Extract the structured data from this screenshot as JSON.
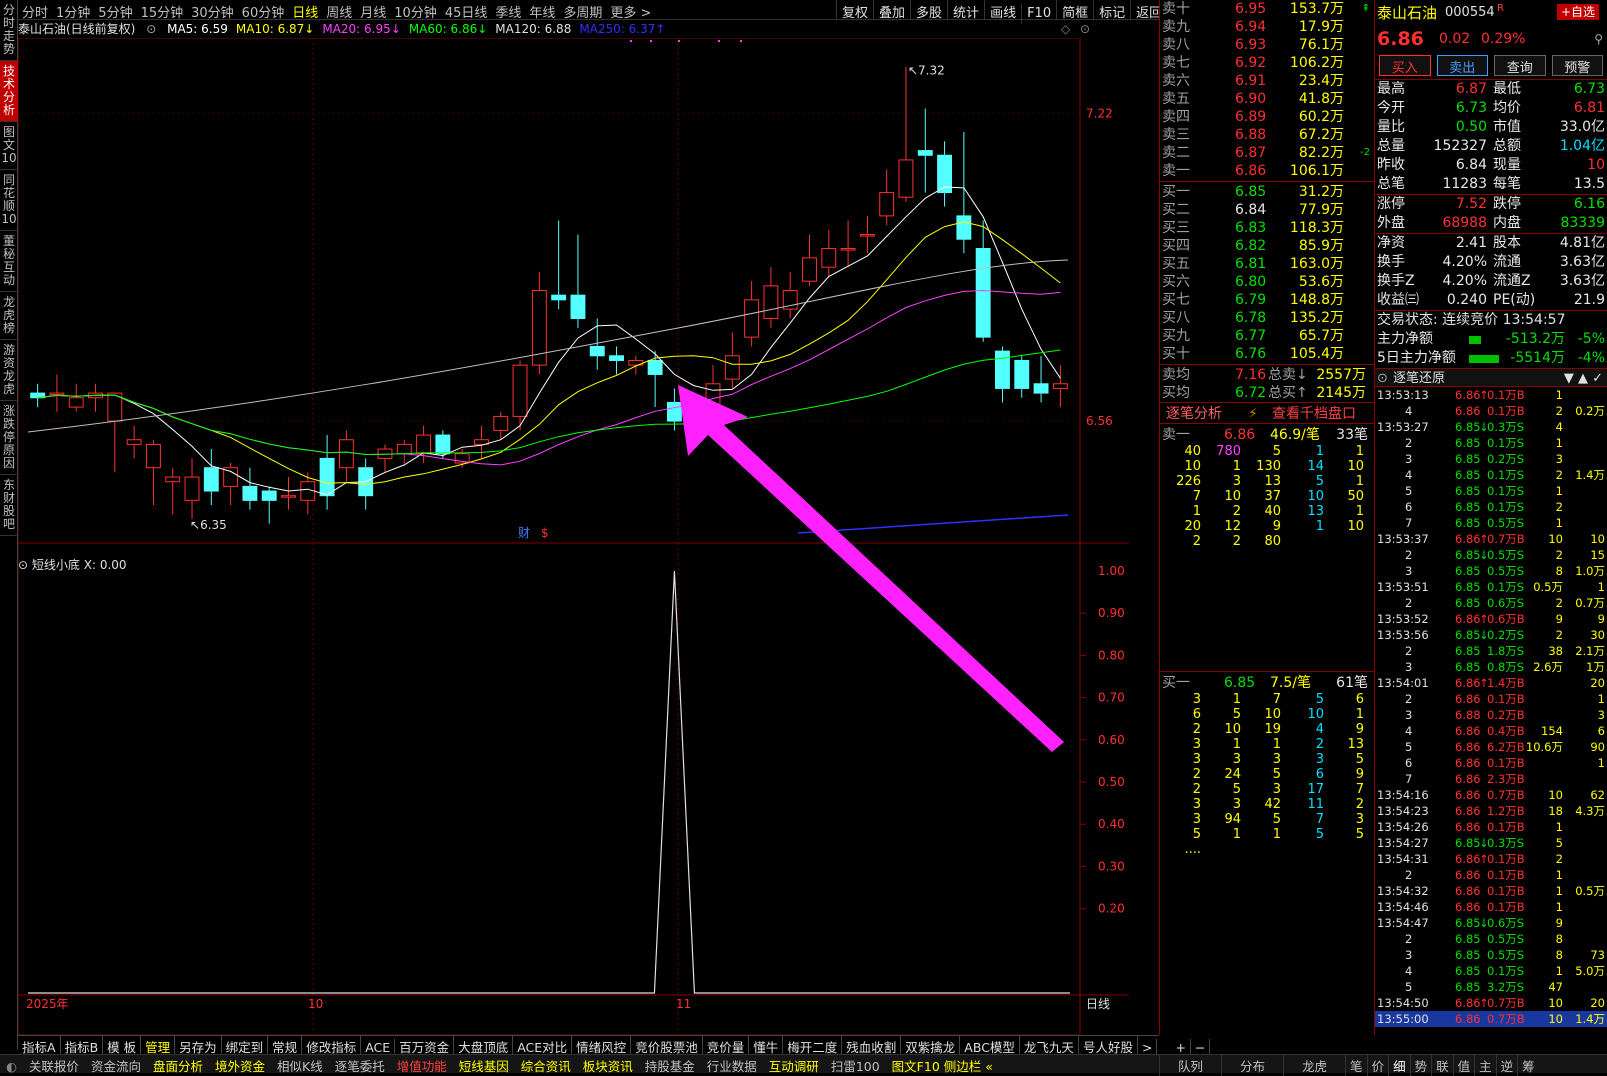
{
  "left_tabs": [
    "分时走势",
    "技术分析",
    "图文10",
    "同花顺10",
    "董秘互动",
    "龙虎榜",
    "游资龙虎",
    "涨跌停原因",
    "东财股吧"
  ],
  "left_tab_active": 1,
  "periods": [
    "分时",
    "1分钟",
    "5分钟",
    "15分钟",
    "30分钟",
    "60分钟",
    "日线",
    "周线",
    "月线",
    "10分钟",
    "45日线",
    "季线",
    "年线",
    "多周期",
    "更多 >"
  ],
  "period_selected": 6,
  "toolbar": [
    "复权",
    "叠加",
    "多股",
    "统计",
    "画线",
    "F10",
    "简框",
    "标记",
    "返回"
  ],
  "chart_header": {
    "title": "泰山石油(日线前复权)",
    "ma": [
      {
        "label": "MA5: 6.59",
        "color": "#ffffff"
      },
      {
        "label": "MA10: 6.87↓",
        "color": "#ffff00"
      },
      {
        "label": "MA20: 6.95↓",
        "color": "#ff40ff"
      },
      {
        "label": "MA60: 6.86↓",
        "color": "#00ff00"
      },
      {
        "label": "MA120: 6.88",
        "color": "#e0e0e0"
      },
      {
        "label": "MA250: 6.37↑",
        "color": "#3030ff"
      }
    ]
  },
  "chart_data": {
    "type": "candlestick",
    "y_axis_labels": [
      "7.22",
      "6.56"
    ],
    "high_label": "7.32",
    "low_label": "6.35",
    "x_labels": [
      "2025年",
      "10",
      "11"
    ],
    "markers": [
      "财",
      "$"
    ],
    "candles": [
      [
        6.62,
        6.61,
        6.64,
        6.59
      ],
      [
        6.62,
        6.62,
        6.66,
        6.58
      ],
      [
        6.59,
        6.61,
        6.64,
        6.58
      ],
      [
        6.61,
        6.62,
        6.64,
        6.58
      ],
      [
        6.56,
        6.62,
        6.6,
        6.45
      ],
      [
        6.51,
        6.52,
        6.55,
        6.48
      ],
      [
        6.46,
        6.51,
        6.52,
        6.38
      ],
      [
        6.43,
        6.44,
        6.46,
        6.36
      ],
      [
        6.39,
        6.44,
        6.48,
        6.35
      ],
      [
        6.46,
        6.41,
        6.5,
        6.38
      ],
      [
        6.42,
        6.46,
        6.47,
        6.38
      ],
      [
        6.42,
        6.39,
        6.46,
        6.37
      ],
      [
        6.41,
        6.39,
        6.42,
        6.34
      ],
      [
        6.4,
        6.4,
        6.44,
        6.37
      ],
      [
        6.39,
        6.43,
        6.45,
        6.36
      ],
      [
        6.48,
        6.4,
        6.53,
        6.37
      ],
      [
        6.46,
        6.52,
        6.54,
        6.43
      ],
      [
        6.46,
        6.4,
        6.48,
        6.37
      ],
      [
        6.48,
        6.5,
        6.51,
        6.45
      ],
      [
        6.49,
        6.51,
        6.52,
        6.47
      ],
      [
        6.49,
        6.53,
        6.55,
        6.47
      ],
      [
        6.53,
        6.49,
        6.54,
        6.48
      ],
      [
        6.47,
        6.49,
        6.5,
        6.46
      ],
      [
        6.51,
        6.52,
        6.55,
        6.48
      ],
      [
        6.54,
        6.57,
        6.58,
        6.52
      ],
      [
        6.57,
        6.68,
        6.69,
        6.54
      ],
      [
        6.68,
        6.84,
        6.88,
        6.66
      ],
      [
        6.83,
        6.82,
        6.99,
        6.8
      ],
      [
        6.83,
        6.78,
        6.96,
        6.76
      ],
      [
        6.72,
        6.7,
        6.78,
        6.67
      ],
      [
        6.7,
        6.69,
        6.72,
        6.66
      ],
      [
        6.68,
        6.69,
        6.7,
        6.66
      ],
      [
        6.69,
        6.66,
        6.71,
        6.59
      ],
      [
        6.6,
        6.56,
        6.63,
        6.54
      ],
      [
        6.56,
        6.58,
        6.6,
        6.53
      ],
      [
        6.58,
        6.64,
        6.68,
        6.56
      ],
      [
        6.65,
        6.7,
        6.75,
        6.63
      ],
      [
        6.74,
        6.82,
        6.86,
        6.72
      ],
      [
        6.78,
        6.85,
        6.89,
        6.76
      ],
      [
        6.8,
        6.84,
        6.88,
        6.78
      ],
      [
        6.86,
        6.91,
        6.96,
        6.85
      ],
      [
        6.89,
        6.93,
        6.97,
        6.87
      ],
      [
        6.93,
        6.93,
        6.99,
        6.89
      ],
      [
        6.96,
        6.96,
        7.0,
        6.92
      ],
      [
        7.0,
        7.05,
        7.1,
        6.98
      ],
      [
        7.04,
        7.12,
        7.32,
        7.03
      ],
      [
        7.14,
        7.13,
        7.23,
        7.05
      ],
      [
        7.13,
        7.05,
        7.16,
        7.02
      ],
      [
        7.0,
        6.95,
        7.18,
        6.92
      ],
      [
        6.93,
        6.74,
        6.99,
        6.73
      ],
      [
        6.71,
        6.63,
        6.72,
        6.6
      ],
      [
        6.69,
        6.63,
        6.7,
        6.61
      ],
      [
        6.64,
        6.62,
        6.7,
        6.6
      ],
      [
        6.63,
        6.64,
        6.68,
        6.59
      ]
    ],
    "indicator": {
      "title": "短线小底",
      "x_label": "X: 0.00",
      "y_ticks": [
        "1.00",
        "0.90",
        "0.80",
        "0.70",
        "0.60",
        "0.50",
        "0.40",
        "0.30",
        "0.20"
      ],
      "spike_index": 33,
      "spike_value": 1.0
    },
    "bottom_label": "日线"
  },
  "indicator_tabs": [
    "指标A",
    "指标B",
    "模 板",
    "管理",
    "另存为",
    "绑定到",
    "常规",
    "修改指标",
    "ACE",
    "百万资金",
    "大盘顶底",
    "ACE对比",
    "情绪风控",
    "竞价股票池",
    "竞价量",
    "懂牛",
    "梅开二度",
    "残血收割",
    "双紫擒龙",
    "ABC模型",
    "龙飞九天",
    "号人好股"
  ],
  "indicator_tab_selected": 3,
  "bottom_bar": [
    {
      "t": "关联报价",
      "c": ""
    },
    {
      "t": "资金流向",
      "c": ""
    },
    {
      "t": "盘面分析",
      "c": "y"
    },
    {
      "t": "境外资金",
      "c": "y"
    },
    {
      "t": "相似K线",
      "c": ""
    },
    {
      "t": "逐笔委托",
      "c": ""
    },
    {
      "t": "增值功能",
      "c": "r"
    },
    {
      "t": "短线基因",
      "c": "y"
    },
    {
      "t": "综合资讯",
      "c": "y"
    },
    {
      "t": "板块资讯",
      "c": "y"
    },
    {
      "t": "持股基金",
      "c": ""
    },
    {
      "t": "行业数据",
      "c": ""
    },
    {
      "t": "互动调研",
      "c": "y"
    },
    {
      "t": "扫雷100",
      "c": ""
    },
    {
      "t": "图文F10 侧边栏 «",
      "c": "y"
    }
  ],
  "bottom_right_tabs": [
    "队列",
    "分布",
    "龙虎",
    "笔",
    "价",
    "细",
    "势",
    "联",
    "值",
    "主",
    "逆",
    "筹"
  ],
  "orderbook": {
    "sells": [
      {
        "l": "卖十",
        "p": "6.95",
        "v": "153.7万",
        "c": "red",
        "mark": "⇞"
      },
      {
        "l": "卖九",
        "p": "6.94",
        "v": "17.9万",
        "c": "red",
        "mark": ""
      },
      {
        "l": "卖八",
        "p": "6.93",
        "v": "76.1万",
        "c": "red",
        "mark": ""
      },
      {
        "l": "卖七",
        "p": "6.92",
        "v": "106.2万",
        "c": "red",
        "mark": ""
      },
      {
        "l": "卖六",
        "p": "6.91",
        "v": "23.4万",
        "c": "red",
        "mark": ""
      },
      {
        "l": "卖五",
        "p": "6.90",
        "v": "41.8万",
        "c": "red",
        "mark": ""
      },
      {
        "l": "卖四",
        "p": "6.89",
        "v": "60.2万",
        "c": "red",
        "mark": ""
      },
      {
        "l": "卖三",
        "p": "6.88",
        "v": "67.2万",
        "c": "red",
        "mark": ""
      },
      {
        "l": "卖二",
        "p": "6.87",
        "v": "82.2万",
        "c": "red",
        "mark": "-2"
      },
      {
        "l": "卖一",
        "p": "6.86",
        "v": "106.1万",
        "c": "red",
        "mark": ""
      }
    ],
    "buys": [
      {
        "l": "买一",
        "p": "6.85",
        "v": "31.2万",
        "c": "grn"
      },
      {
        "l": "买二",
        "p": "6.84",
        "v": "77.9万",
        "c": "wht"
      },
      {
        "l": "买三",
        "p": "6.83",
        "v": "118.3万",
        "c": "grn"
      },
      {
        "l": "买四",
        "p": "6.82",
        "v": "85.9万",
        "c": "grn"
      },
      {
        "l": "买五",
        "p": "6.81",
        "v": "163.0万",
        "c": "grn"
      },
      {
        "l": "买六",
        "p": "6.80",
        "v": "53.6万",
        "c": "grn"
      },
      {
        "l": "买七",
        "p": "6.79",
        "v": "148.8万",
        "c": "grn"
      },
      {
        "l": "买八",
        "p": "6.78",
        "v": "135.2万",
        "c": "grn"
      },
      {
        "l": "买九",
        "p": "6.77",
        "v": "65.7万",
        "c": "grn"
      },
      {
        "l": "买十",
        "p": "6.76",
        "v": "105.4万",
        "c": "grn"
      }
    ],
    "avg_sell": {
      "l": "卖均",
      "p": "7.16",
      "tl": "总卖",
      "v": "2557万"
    },
    "avg_buy": {
      "l": "买均",
      "p": "6.72",
      "tl": "总买",
      "v": "2145万"
    },
    "tab1": "逐笔分析",
    "tab2": "查看千档盘口",
    "sell1_hdr": {
      "l": "卖一",
      "p": "6.86",
      "v": "46.9/笔",
      "n": "33笔"
    },
    "sell1_queue": [
      [
        "40",
        "780",
        "5",
        "1",
        "1"
      ],
      [
        "10",
        "1",
        "130",
        "14",
        "10"
      ],
      [
        "226",
        "3",
        "13",
        "5",
        "1"
      ],
      [
        "7",
        "10",
        "37",
        "10",
        "50"
      ],
      [
        "1",
        "2",
        "40",
        "13",
        "1"
      ],
      [
        "20",
        "12",
        "9",
        "1",
        "10"
      ],
      [
        "2",
        "2",
        "80",
        "",
        ""
      ]
    ],
    "buy1_hdr": {
      "l": "买一",
      "p": "6.85",
      "v": "7.5/笔",
      "n": "61笔"
    },
    "buy1_queue": [
      [
        "3",
        "1",
        "7",
        "5",
        "6"
      ],
      [
        "6",
        "5",
        "10",
        "10",
        "1"
      ],
      [
        "2",
        "10",
        "19",
        "4",
        "9"
      ],
      [
        "3",
        "1",
        "1",
        "2",
        "13"
      ],
      [
        "3",
        "3",
        "3",
        "3",
        "5"
      ],
      [
        "2",
        "24",
        "5",
        "6",
        "9"
      ],
      [
        "2",
        "5",
        "3",
        "17",
        "7"
      ],
      [
        "3",
        "3",
        "42",
        "11",
        "2"
      ],
      [
        "3",
        "94",
        "5",
        "7",
        "3"
      ],
      [
        "5",
        "1",
        "1",
        "5",
        "5"
      ],
      [
        "....",
        "",
        "",
        "",
        ""
      ]
    ]
  },
  "stock": {
    "name": "泰山石油",
    "code": "000554",
    "r_badge": "R",
    "add_btn": "+自选",
    "price": "6.86",
    "change": "0.02",
    "pct": "0.29%",
    "buttons": [
      "买入",
      "卖出",
      "查询",
      "预警"
    ],
    "stats": [
      [
        {
          "l": "最高",
          "v": "6.87",
          "c": "red"
        },
        {
          "l": "最低",
          "v": "6.73",
          "c": "grn"
        }
      ],
      [
        {
          "l": "今开",
          "v": "6.73",
          "c": "grn"
        },
        {
          "l": "均价",
          "v": "6.81",
          "c": "red"
        }
      ],
      [
        {
          "l": "量比",
          "v": "0.50",
          "c": "grn"
        },
        {
          "l": "市值",
          "v": "33.0亿",
          "c": "wht"
        }
      ],
      [
        {
          "l": "总量",
          "v": "152327",
          "c": "wht"
        },
        {
          "l": "总额",
          "v": "1.04亿",
          "c": "cyan"
        }
      ],
      [
        {
          "l": "昨收",
          "v": "6.84",
          "c": "wht"
        },
        {
          "l": "现量",
          "v": "10",
          "c": "red"
        }
      ],
      [
        {
          "l": "总笔",
          "v": "11283",
          "c": "wht"
        },
        {
          "l": "每笔",
          "v": "13.5",
          "c": "wht"
        }
      ],
      [
        {
          "l": "涨停",
          "v": "7.52",
          "c": "red"
        },
        {
          "l": "跌停",
          "v": "6.16",
          "c": "grn"
        }
      ],
      [
        {
          "l": "外盘",
          "v": "68988",
          "c": "red"
        },
        {
          "l": "内盘",
          "v": "83339",
          "c": "grn"
        }
      ],
      [
        {
          "l": "净资",
          "v": "2.41",
          "c": "wht"
        },
        {
          "l": "股本",
          "v": "4.81亿",
          "c": "wht"
        }
      ],
      [
        {
          "l": "换手",
          "v": "4.20%",
          "c": "wht"
        },
        {
          "l": "流通",
          "v": "3.63亿",
          "c": "wht"
        }
      ],
      [
        {
          "l": "换手Z",
          "v": "4.20%",
          "c": "wht"
        },
        {
          "l": "流通Z",
          "v": "3.63亿",
          "c": "wht"
        }
      ],
      [
        {
          "l": "收益㈢",
          "v": "0.240",
          "c": "wht"
        },
        {
          "l": "PE(动)",
          "v": "21.9",
          "c": "wht"
        }
      ]
    ],
    "trade_status": "交易状态: 连续竞价 13:54:57",
    "main_net": {
      "l": "主力净额",
      "v": "-513.2万",
      "p": "-5%"
    },
    "main5_net": {
      "l": "5日主力净额",
      "v": "-5514万",
      "p": "-4%"
    },
    "tick_title": "逐笔还原"
  },
  "ticks": [
    {
      "t": "13:53:13",
      "p": "6.86",
      "d": "↑",
      "v": "0.1万",
      "s": "B",
      "n": "1",
      "x": "",
      "c": "red"
    },
    {
      "t": "4",
      "p": "6.86",
      "d": "",
      "v": "0.1万",
      "s": "B",
      "n": "2",
      "x": "0.2万",
      "c": "red"
    },
    {
      "t": "13:53:27",
      "p": "6.85",
      "d": "↓",
      "v": "0.3万",
      "s": "S",
      "n": "4",
      "x": "",
      "c": "grn"
    },
    {
      "t": "2",
      "p": "6.85",
      "d": "",
      "v": "0.1万",
      "s": "S",
      "n": "1",
      "x": "",
      "c": "grn"
    },
    {
      "t": "3",
      "p": "6.85",
      "d": "",
      "v": "0.2万",
      "s": "S",
      "n": "3",
      "x": "",
      "c": "grn"
    },
    {
      "t": "4",
      "p": "6.85",
      "d": "",
      "v": "0.1万",
      "s": "S",
      "n": "2",
      "x": "1.4万",
      "c": "grn"
    },
    {
      "t": "5",
      "p": "6.85",
      "d": "",
      "v": "0.1万",
      "s": "S",
      "n": "1",
      "x": "",
      "c": "grn"
    },
    {
      "t": "6",
      "p": "6.85",
      "d": "",
      "v": "0.1万",
      "s": "S",
      "n": "2",
      "x": "",
      "c": "grn"
    },
    {
      "t": "7",
      "p": "6.85",
      "d": "",
      "v": "0.5万",
      "s": "S",
      "n": "1",
      "x": "",
      "c": "grn"
    },
    {
      "t": "13:53:37",
      "p": "6.86",
      "d": "↑",
      "v": "0.7万",
      "s": "B",
      "n": "10",
      "x": "10",
      "c": "red"
    },
    {
      "t": "2",
      "p": "6.85",
      "d": "↓",
      "v": "0.5万",
      "s": "S",
      "n": "2",
      "x": "15",
      "c": "grn"
    },
    {
      "t": "3",
      "p": "6.85",
      "d": "",
      "v": "0.5万",
      "s": "S",
      "n": "8",
      "x": "1.0万",
      "c": "grn"
    },
    {
      "t": "13:53:51",
      "p": "6.85",
      "d": "",
      "v": "0.1万",
      "s": "S",
      "n": "0.5万",
      "x": "1",
      "c": "grn"
    },
    {
      "t": "2",
      "p": "6.85",
      "d": "",
      "v": "0.6万",
      "s": "S",
      "n": "2",
      "x": "0.7万",
      "c": "grn"
    },
    {
      "t": "13:53:52",
      "p": "6.86",
      "d": "↑",
      "v": "0.6万",
      "s": "B",
      "n": "9",
      "x": "9",
      "c": "red"
    },
    {
      "t": "13:53:56",
      "p": "6.85",
      "d": "↓",
      "v": "0.2万",
      "s": "S",
      "n": "2",
      "x": "30",
      "c": "grn"
    },
    {
      "t": "2",
      "p": "6.85",
      "d": "",
      "v": "1.8万",
      "s": "S",
      "n": "38",
      "x": "2.1万",
      "c": "grn"
    },
    {
      "t": "3",
      "p": "6.85",
      "d": "",
      "v": "0.8万",
      "s": "S",
      "n": "2.6万",
      "x": "1万",
      "c": "grn"
    },
    {
      "t": "13:54:01",
      "p": "6.86",
      "d": "↑",
      "v": "1.4万",
      "s": "B",
      "n": "",
      "x": "20",
      "c": "red"
    },
    {
      "t": "2",
      "p": "6.86",
      "d": "",
      "v": "0.1万",
      "s": "B",
      "n": "",
      "x": "1",
      "c": "red"
    },
    {
      "t": "3",
      "p": "6.88",
      "d": "",
      "v": "0.2万",
      "s": "B",
      "n": "",
      "x": "3",
      "c": "red"
    },
    {
      "t": "4",
      "p": "6.86",
      "d": "",
      "v": "0.4万",
      "s": "B",
      "n": "154",
      "x": "6",
      "c": "red"
    },
    {
      "t": "5",
      "p": "6.86",
      "d": "",
      "v": "6.2万",
      "s": "B",
      "n": "10.6万",
      "x": "90",
      "c": "red"
    },
    {
      "t": "6",
      "p": "6.86",
      "d": "",
      "v": "0.1万",
      "s": "B",
      "n": "",
      "x": "1",
      "c": "red"
    },
    {
      "t": "7",
      "p": "6.86",
      "d": "",
      "v": "2.3万",
      "s": "B",
      "n": "",
      "x": "",
      "c": "red"
    },
    {
      "t": "13:54:16",
      "p": "6.86",
      "d": "",
      "v": "0.7万",
      "s": "B",
      "n": "10",
      "x": "62",
      "c": "red"
    },
    {
      "t": "13:54:23",
      "p": "6.86",
      "d": "",
      "v": "1.2万",
      "s": "B",
      "n": "18",
      "x": "4.3万",
      "c": "red"
    },
    {
      "t": "13:54:26",
      "p": "6.86",
      "d": "",
      "v": "0.1万",
      "s": "B",
      "n": "1",
      "x": "",
      "c": "red"
    },
    {
      "t": "13:54:27",
      "p": "6.85",
      "d": "↓",
      "v": "0.3万",
      "s": "S",
      "n": "5",
      "x": "",
      "c": "grn"
    },
    {
      "t": "13:54:31",
      "p": "6.86",
      "d": "↑",
      "v": "0.1万",
      "s": "B",
      "n": "2",
      "x": "",
      "c": "red"
    },
    {
      "t": "2",
      "p": "6.86",
      "d": "",
      "v": "0.1万",
      "s": "B",
      "n": "1",
      "x": "",
      "c": "red"
    },
    {
      "t": "13:54:32",
      "p": "6.86",
      "d": "",
      "v": "0.1万",
      "s": "B",
      "n": "1",
      "x": "0.5万",
      "c": "red"
    },
    {
      "t": "13:54:46",
      "p": "6.86",
      "d": "",
      "v": "0.1万",
      "s": "B",
      "n": "1",
      "x": "",
      "c": "red"
    },
    {
      "t": "13:54:47",
      "p": "6.85",
      "d": "↓",
      "v": "0.6万",
      "s": "S",
      "n": "9",
      "x": "",
      "c": "grn"
    },
    {
      "t": "2",
      "p": "6.85",
      "d": "",
      "v": "0.5万",
      "s": "S",
      "n": "8",
      "x": "",
      "c": "grn"
    },
    {
      "t": "3",
      "p": "6.85",
      "d": "",
      "v": "0.5万",
      "s": "S",
      "n": "8",
      "x": "73",
      "c": "grn"
    },
    {
      "t": "4",
      "p": "6.85",
      "d": "",
      "v": "0.1万",
      "s": "S",
      "n": "1",
      "x": "5.0万",
      "c": "grn"
    },
    {
      "t": "5",
      "p": "6.85",
      "d": "",
      "v": "3.2万",
      "s": "S",
      "n": "47",
      "x": "",
      "c": "grn"
    },
    {
      "t": "13:54:50",
      "p": "6.86",
      "d": "↑",
      "v": "0.7万",
      "s": "B",
      "n": "10",
      "x": "20",
      "c": "red"
    },
    {
      "t": "13:55:00",
      "p": "6.86",
      "d": "",
      "v": "0.7万",
      "s": "B",
      "n": "10",
      "x": "1.4万",
      "c": "red"
    }
  ]
}
